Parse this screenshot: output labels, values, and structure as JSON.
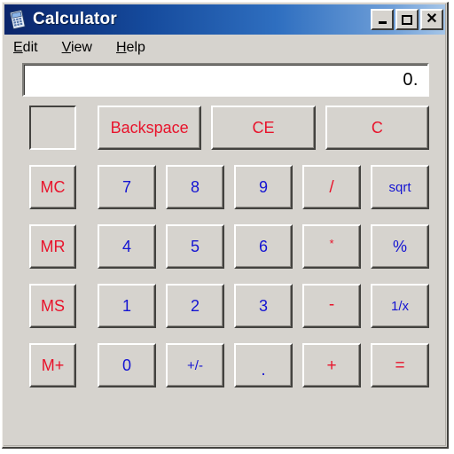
{
  "window": {
    "title": "Calculator",
    "icon": "calculator-icon",
    "controls": [
      {
        "name": "minimize",
        "glyph": "_"
      },
      {
        "name": "maximize",
        "glyph": "□"
      },
      {
        "name": "close",
        "glyph": "✕"
      }
    ],
    "titlebar_gradient_start": "#0a246a",
    "titlebar_gradient_end": "#a6c6e8",
    "face_color": "#d6d3ce"
  },
  "menubar": {
    "items": [
      {
        "accel": "E",
        "rest": "dit",
        "label": "Edit"
      },
      {
        "accel": "V",
        "rest": "iew",
        "label": "View"
      },
      {
        "accel": "H",
        "rest": "elp",
        "label": "Help"
      }
    ]
  },
  "display": {
    "value": "0.",
    "align": "right"
  },
  "memory_indicator": {
    "value": ""
  },
  "top_row": [
    {
      "label": "Backspace",
      "color": "#e8132b",
      "style": "red"
    },
    {
      "label": "CE",
      "color": "#e8132b",
      "style": "red"
    },
    {
      "label": "C",
      "color": "#e8132b",
      "style": "red"
    }
  ],
  "keypad_rows": [
    {
      "memory": {
        "label": "MC",
        "style": "red"
      },
      "keys": [
        {
          "label": "7",
          "style": "blue"
        },
        {
          "label": "8",
          "style": "blue"
        },
        {
          "label": "9",
          "style": "blue"
        },
        {
          "label": "/",
          "style": "red-op"
        },
        {
          "label": "sqrt",
          "style": "blue-small"
        }
      ]
    },
    {
      "memory": {
        "label": "MR",
        "style": "red"
      },
      "keys": [
        {
          "label": "4",
          "style": "blue"
        },
        {
          "label": "5",
          "style": "blue"
        },
        {
          "label": "6",
          "style": "blue"
        },
        {
          "label": "*",
          "style": "red-star"
        },
        {
          "label": "%",
          "style": "blue"
        }
      ]
    },
    {
      "memory": {
        "label": "MS",
        "style": "red"
      },
      "keys": [
        {
          "label": "1",
          "style": "blue"
        },
        {
          "label": "2",
          "style": "blue"
        },
        {
          "label": "3",
          "style": "blue"
        },
        {
          "label": "-",
          "style": "red-minus"
        },
        {
          "label": "1/x",
          "style": "blue-small"
        }
      ]
    },
    {
      "memory": {
        "label": "M+",
        "style": "red"
      },
      "keys": [
        {
          "label": "0",
          "style": "blue"
        },
        {
          "label": "+/-",
          "style": "blue-small"
        },
        {
          "label": ".",
          "style": "blue-dot"
        },
        {
          "label": "+",
          "style": "red-op"
        },
        {
          "label": "=",
          "style": "red-op"
        }
      ]
    }
  ],
  "colors": {
    "red": "#e8132b",
    "blue": "#1414d2",
    "face": "#d6d3ce",
    "shadow": "#43423f",
    "highlight": "#ffffff"
  }
}
